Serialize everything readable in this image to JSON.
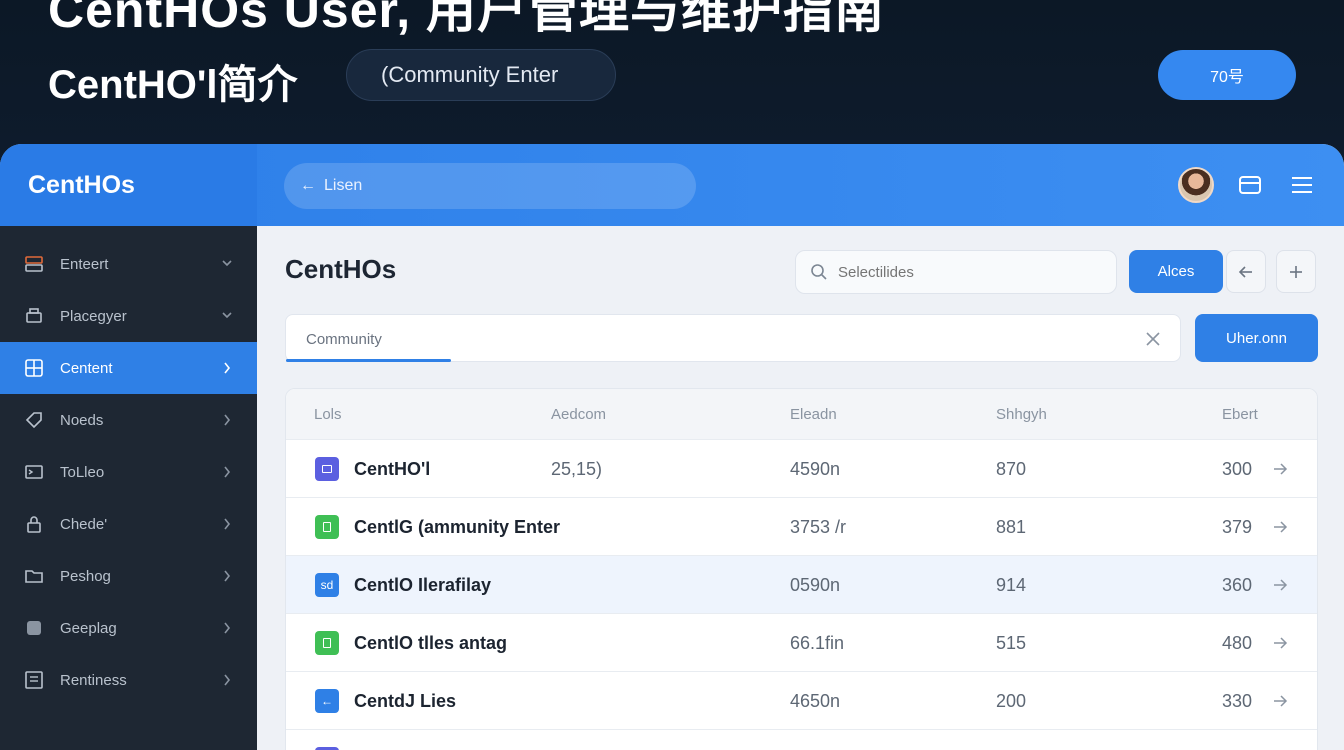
{
  "banner": {
    "title": "CentHOs User, 用户管理与维护指南",
    "subtitle": "CentHO'l简介",
    "chip": "(Community Enter",
    "button": "70号"
  },
  "topbar": {
    "brand": "CentHOs",
    "search_placeholder": "Lisen"
  },
  "sidebar": {
    "items": [
      {
        "label": "Enteert",
        "icon": "server-icon",
        "active": false
      },
      {
        "label": "Placegyer",
        "icon": "printer-icon",
        "active": false
      },
      {
        "label": "Centent",
        "icon": "grid-icon",
        "active": true
      },
      {
        "label": "Noeds",
        "icon": "tag-icon",
        "active": false
      },
      {
        "label": "ToLleo",
        "icon": "terminal-icon",
        "active": false
      },
      {
        "label": "Chede'",
        "icon": "lock-icon",
        "active": false
      },
      {
        "label": "Peshog",
        "icon": "folder-icon",
        "active": false
      },
      {
        "label": "Geeplag",
        "icon": "package-icon",
        "active": false
      },
      {
        "label": "Rentiness",
        "icon": "list-icon",
        "active": false
      }
    ]
  },
  "main": {
    "title": "CentHOs",
    "search_placeholder": "Selectilides",
    "primary_button": "Alces",
    "filter_value": "Community",
    "filter_button": "Uher.onn"
  },
  "table": {
    "headers": [
      "Lols",
      "Aedcom",
      "Eleadn",
      "Shhgyh",
      "Ebert"
    ],
    "rows": [
      {
        "icon_color": "#5b5fe0",
        "icon_glyph": "",
        "name": "CentHO'l",
        "c2": "25,15)",
        "c3": "4590n",
        "c4": "870",
        "c5": "300"
      },
      {
        "icon_color": "#3fbf55",
        "icon_glyph": "",
        "name": "CentlG (ammunity Enter",
        "c2": "",
        "c3": "3753 /r",
        "c4": "881",
        "c5": "379"
      },
      {
        "icon_color": "#2f80e6",
        "icon_glyph": "sd",
        "name": "CentlO Ilerafilay",
        "c2": "",
        "c3": "0590n",
        "c4": "914",
        "c5": "360"
      },
      {
        "icon_color": "#3fbf55",
        "icon_glyph": "",
        "name": "CentlO tlles antag",
        "c2": "",
        "c3": "66.1fin",
        "c4": "515",
        "c5": "480"
      },
      {
        "icon_color": "#2f80e6",
        "icon_glyph": "←",
        "name": "CentdJ Lies",
        "c2": "",
        "c3": "4650n",
        "c4": "200",
        "c5": "330"
      }
    ]
  },
  "colors": {
    "accent": "#2f80e6",
    "sidebar_bg": "#1e2733",
    "banner_bg": "#0c1826"
  }
}
